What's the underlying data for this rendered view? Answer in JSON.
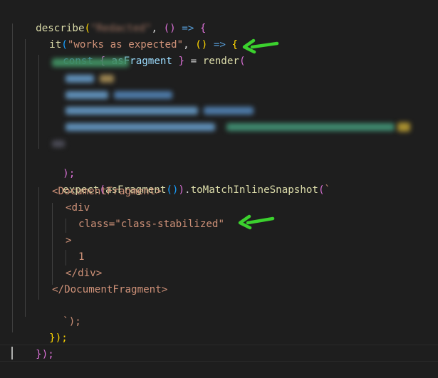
{
  "editor": {
    "line1": {
      "describe": "describe",
      "open_paren": "(",
      "blurred_name": "\"Redacted\"",
      "comma": ",",
      "arrow_parens": "()",
      "arrow": "=>",
      "brace": "{"
    },
    "line2": {
      "it": "it",
      "open_paren": "(",
      "test_name": "\"works as expected\"",
      "comma": ",",
      "arrow_parens": "()",
      "arrow": "=>",
      "brace": "{"
    },
    "line3": {
      "const": "const",
      "destructure_open": "{",
      "as_fragment": "asFragment",
      "destructure_close": "}",
      "equals": "=",
      "render": "render",
      "open_paren": "("
    },
    "line10": {
      "close": ");"
    },
    "line11": {
      "expect": "expect",
      "open_paren": "(",
      "as_fragment_call": "asFragment",
      "call_parens": "()",
      "close_paren": ")",
      "dot": ".",
      "matcher": "toMatchInlineSnapshot",
      "matcher_open": "(",
      "backtick": "`"
    },
    "snapshot": {
      "fragment_open": "<DocumentFragment>",
      "div_open": "<div",
      "class_attr": "class=\"class-stabilized\"",
      "gt": ">",
      "content": "1",
      "div_close": "</div>",
      "fragment_close": "</DocumentFragment>",
      "end": "`);"
    },
    "line17": {
      "close": "});"
    },
    "line18": {
      "close": "});"
    }
  },
  "colors": {
    "background": "#1e1e1e",
    "keyword": "#569cd6",
    "function": "#dcdcaa",
    "string": "#ce9178",
    "variable": "#9cdcfe",
    "bracket_gold": "#ffd700",
    "bracket_purple": "#da70d6",
    "bracket_blue": "#179fff",
    "arrow_annotation": "#3bd12e"
  }
}
